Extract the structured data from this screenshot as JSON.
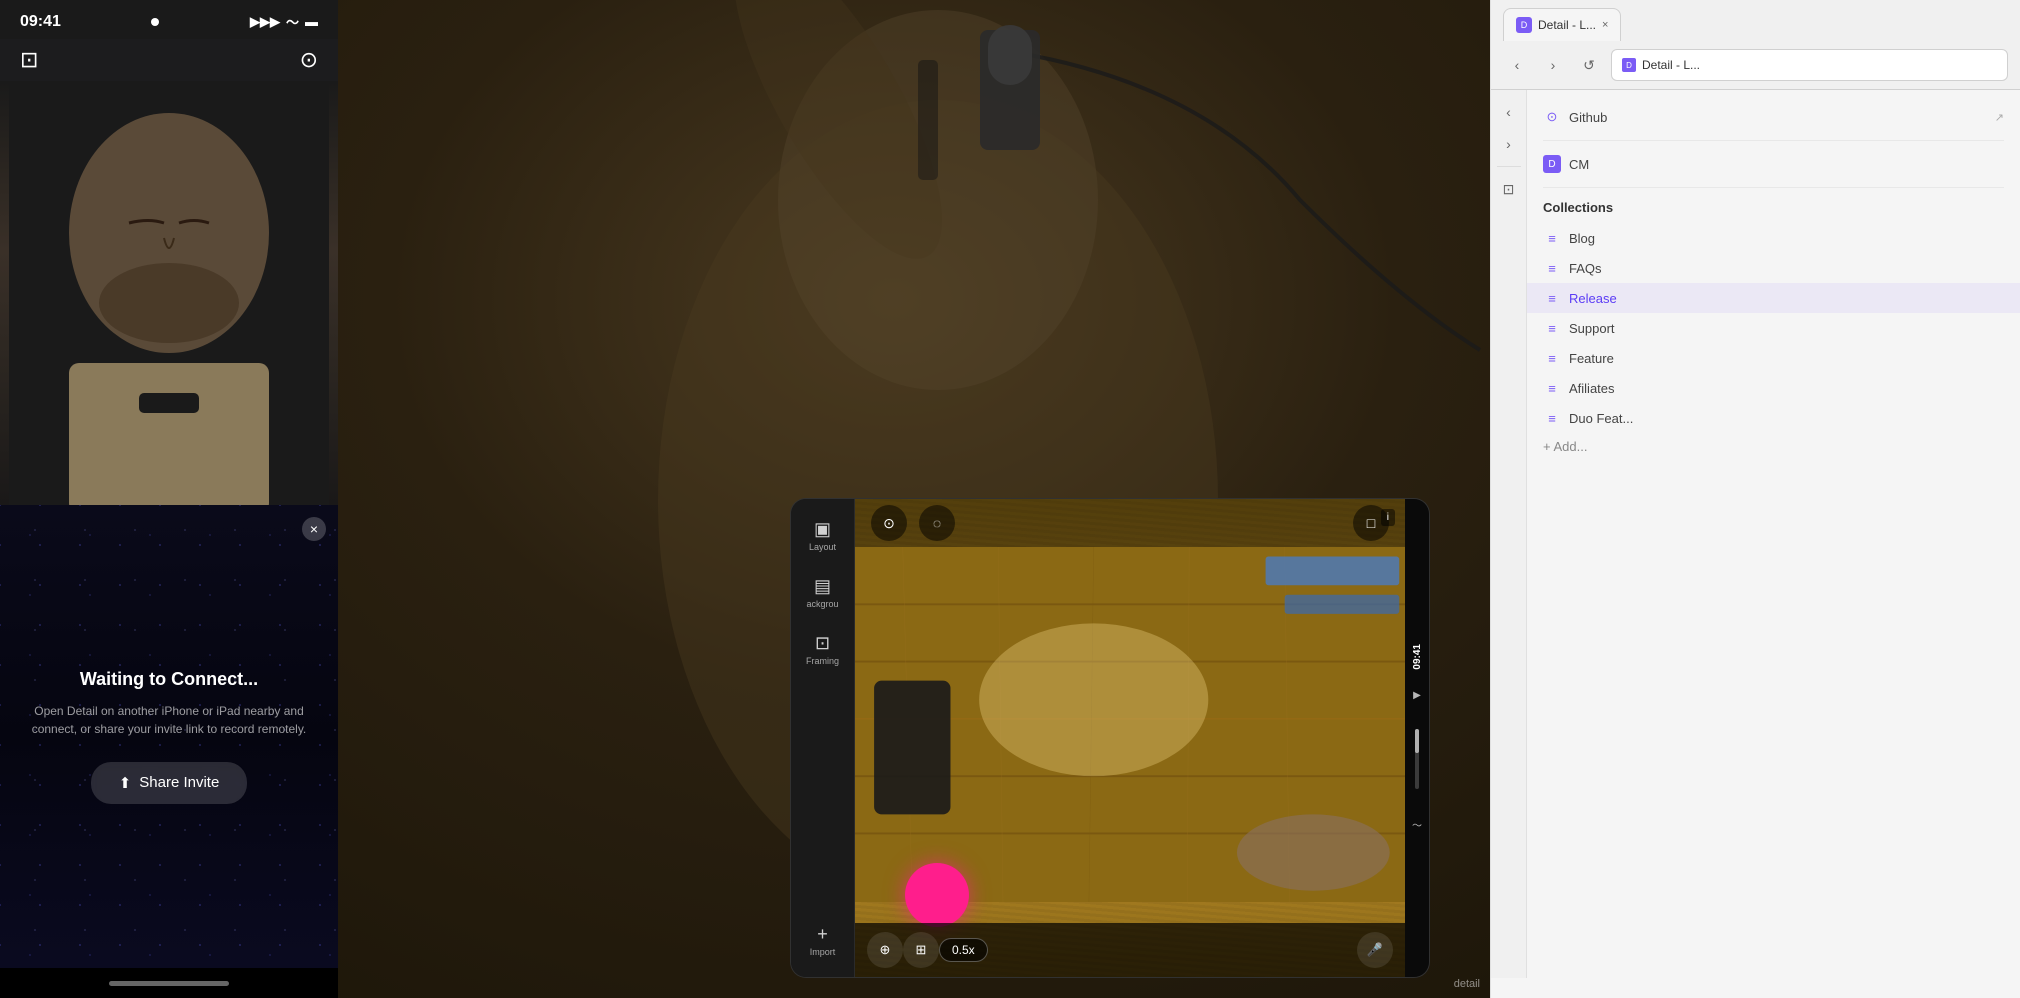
{
  "app": {
    "title": "Detail - L...",
    "bottom_label": "detail"
  },
  "phone": {
    "status_bar": {
      "time": "09:41",
      "signal_icon": "▶",
      "wifi_icon": "wifi",
      "battery_icon": "battery"
    },
    "waiting_panel": {
      "title": "Waiting to Connect...",
      "subtitle": "Open Detail on another iPhone or iPad nearby and connect, or share your invite link to record remotely.",
      "close_button": "×",
      "share_invite_label": "Share Invite",
      "share_icon": "⬆"
    },
    "home_bar": ""
  },
  "tablet": {
    "sidebar": {
      "items": [
        {
          "icon": "▣",
          "label": "Layout"
        },
        {
          "icon": "▤",
          "label": "ackgrou"
        },
        {
          "icon": "⬡",
          "label": "Framing"
        }
      ],
      "import_label": "Import",
      "import_icon": "+"
    },
    "toolbar": {
      "record_button_color": "#FF1E8C",
      "zoom_level": "0.5x",
      "camera_icon": "📷",
      "multi_icon": "⊞",
      "mic_icon": "🎤"
    },
    "status_bar": {
      "time": "09:41",
      "battery": "battery"
    }
  },
  "browser": {
    "tabs": [
      {
        "label": "Detail - L...",
        "favicon_color": "#7B5CF5",
        "favicon_text": "D",
        "active": true
      }
    ],
    "nav": {
      "back_disabled": false,
      "forward_disabled": false,
      "refresh": "↺"
    },
    "address": "Detail - L...",
    "address_favicon_color": "#7B5CF5",
    "address_favicon_text": "D"
  },
  "collections": {
    "header": "Collections",
    "items": [
      {
        "label": "Blog",
        "icon": "≡",
        "active": false
      },
      {
        "label": "FAQs",
        "icon": "≡",
        "active": false
      },
      {
        "label": "Release",
        "icon": "≡",
        "active": true
      },
      {
        "label": "Support",
        "icon": "≡",
        "active": false
      },
      {
        "label": "Feature",
        "icon": "≡",
        "active": false
      },
      {
        "label": "Afiliates",
        "icon": "≡",
        "active": false
      },
      {
        "label": "Duo Feat...",
        "icon": "≡",
        "active": false
      }
    ],
    "add_label": "+ Add..."
  },
  "sidebar_nav": {
    "github_label": "Github",
    "github_icon": "⊙",
    "cm_label": "CM",
    "cm_icon": "D"
  }
}
